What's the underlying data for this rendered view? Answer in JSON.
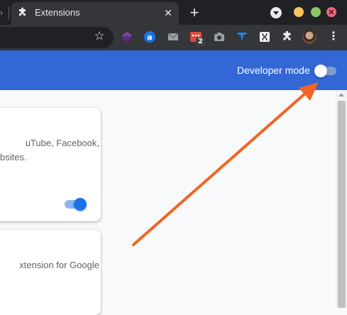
{
  "tab": {
    "title": "Extensions",
    "icon": "puzzle-icon",
    "close_glyph": "✕"
  },
  "tabstrip": {
    "new_tab_glyph": "+",
    "prev_tab_glyph": "›",
    "window_buttons": [
      "minimize",
      "maximize",
      "close"
    ]
  },
  "toolbar": {
    "star_glyph": "☆",
    "extensions": [
      "layers-extension-icon",
      "at-sign-extension-icon",
      "mail-extension-icon",
      "todoist-extension-icon",
      "camera-extension-icon",
      "vpn-extension-icon",
      "dna-extension-icon",
      "puzzle-extensions-icon",
      "profile-avatar"
    ],
    "badge_count": "2",
    "menu_glyph": "⋮"
  },
  "header": {
    "developer_mode_label": "Developer mode",
    "developer_mode_enabled": false
  },
  "cards": [
    {
      "description_lines": [
        "uTube, Facebook,",
        "bsites."
      ],
      "enabled": true
    },
    {
      "description_lines": [
        "xtension for Google"
      ]
    }
  ],
  "colors": {
    "header": "#3367d6",
    "tabstrip": "#202124",
    "toolbar": "#35363a",
    "annotation_arrow": "#f26522",
    "toggle_on": "#1a73e8"
  }
}
